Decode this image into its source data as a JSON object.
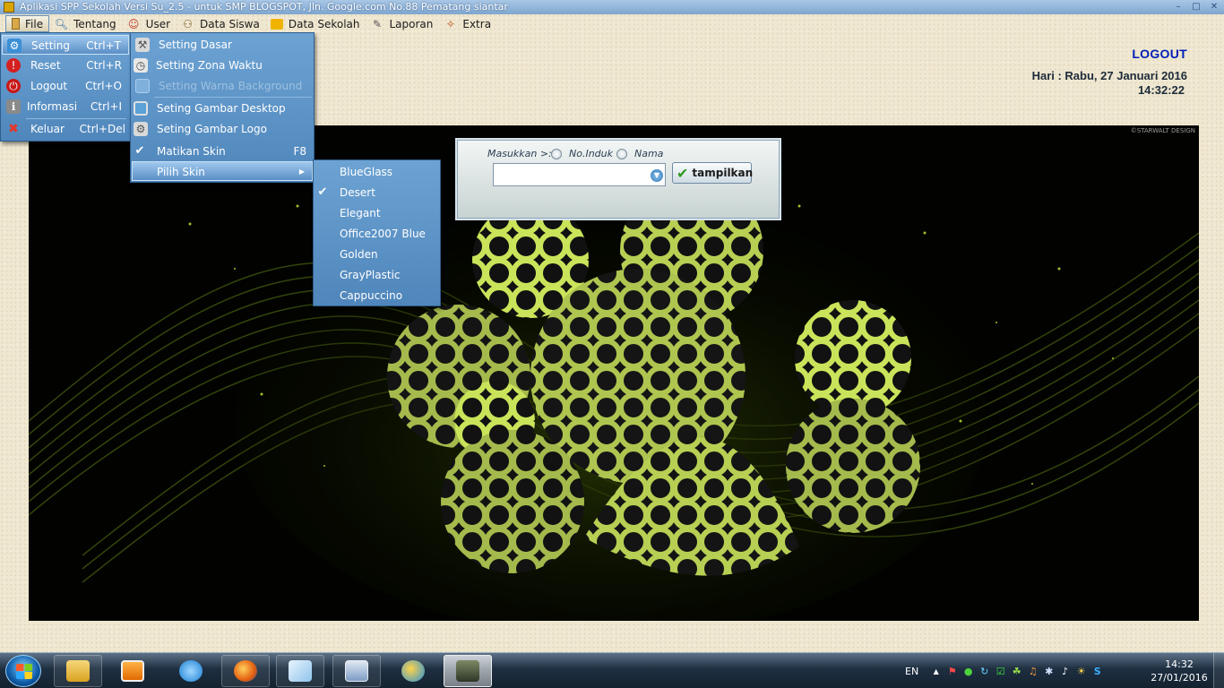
{
  "window": {
    "title": "Aplikasi SPP Sekolah Versi Su_2.5 - untuk SMP BLOGSPOT, Jln. Google.com No.88 Pematang siantar",
    "minimize_icon": "minimize-icon",
    "maximize_icon": "maximize-icon",
    "close_icon": "close-icon"
  },
  "menubar": {
    "items": [
      {
        "label": "File",
        "icon": "file-icon"
      },
      {
        "label": "Tentang",
        "icon": "magnifier-icon"
      },
      {
        "label": "User",
        "icon": "user-icon"
      },
      {
        "label": "Data Siswa",
        "icon": "students-icon"
      },
      {
        "label": "Data Sekolah",
        "icon": "folder-icon"
      },
      {
        "label": "Laporan",
        "icon": "pen-icon"
      },
      {
        "label": "Extra",
        "icon": "wand-icon"
      }
    ]
  },
  "header": {
    "logout": "LOGOUT",
    "date": "Hari : Rabu, 27 Januari 2016",
    "time": "14:32:22"
  },
  "wallpaper": {
    "credit": "©STARWALT DESIGN"
  },
  "search": {
    "label": "Masukkan >:",
    "option1": "No.Induk",
    "option2": "Nama",
    "value": "",
    "button": "tampilkan"
  },
  "file_menu": {
    "items": [
      {
        "label": "Setting",
        "shortcut": "Ctrl+T",
        "icon": "gear-icon"
      },
      {
        "label": "Reset",
        "shortcut": "Ctrl+R",
        "icon": "reset-icon"
      },
      {
        "label": "Logout",
        "shortcut": "Ctrl+O",
        "icon": "power-icon"
      },
      {
        "label": "Informasi",
        "shortcut": "Ctrl+I",
        "icon": "info-icon"
      },
      {
        "label": "Keluar",
        "shortcut": "Ctrl+Del",
        "icon": "exit-icon"
      }
    ]
  },
  "setting_menu": {
    "items": [
      {
        "label": "Setting Dasar",
        "icon": "tools-icon"
      },
      {
        "label": "Setting Zona Waktu",
        "icon": "clock-icon"
      },
      {
        "label": "Setting Warna Background",
        "icon": "monitor-icon"
      },
      {
        "label": "Seting Gambar Desktop",
        "icon": "desktop-icon"
      },
      {
        "label": "Seting Gambar Logo",
        "icon": "logo-icon"
      },
      {
        "label": "Matikan Skin",
        "shortcut": "F8",
        "icon": "check-icon"
      },
      {
        "label": "Pilih Skin",
        "icon": "submenu-arrow-icon"
      }
    ]
  },
  "skin_menu": {
    "selected": "Desert",
    "items": [
      "BlueGlass",
      "Desert",
      "Elegant",
      "Office2007 Blue",
      "Golden",
      "GrayPlastic",
      "Cappuccino"
    ]
  },
  "taskbar": {
    "apps": [
      "explorer-icon",
      "media-player-icon",
      "internet-explorer-icon",
      "firefox-icon",
      "notes-icon",
      "vb-app-icon",
      "globe-icon",
      "spp-app-icon"
    ],
    "lang": "EN",
    "time": "14:32",
    "date": "27/01/2016"
  },
  "colors": {
    "menu_blue": "#5b93c7",
    "logout_blue": "#0020b8",
    "desert": "#eee6cf",
    "wallpaper_green": "#a6d62a"
  }
}
